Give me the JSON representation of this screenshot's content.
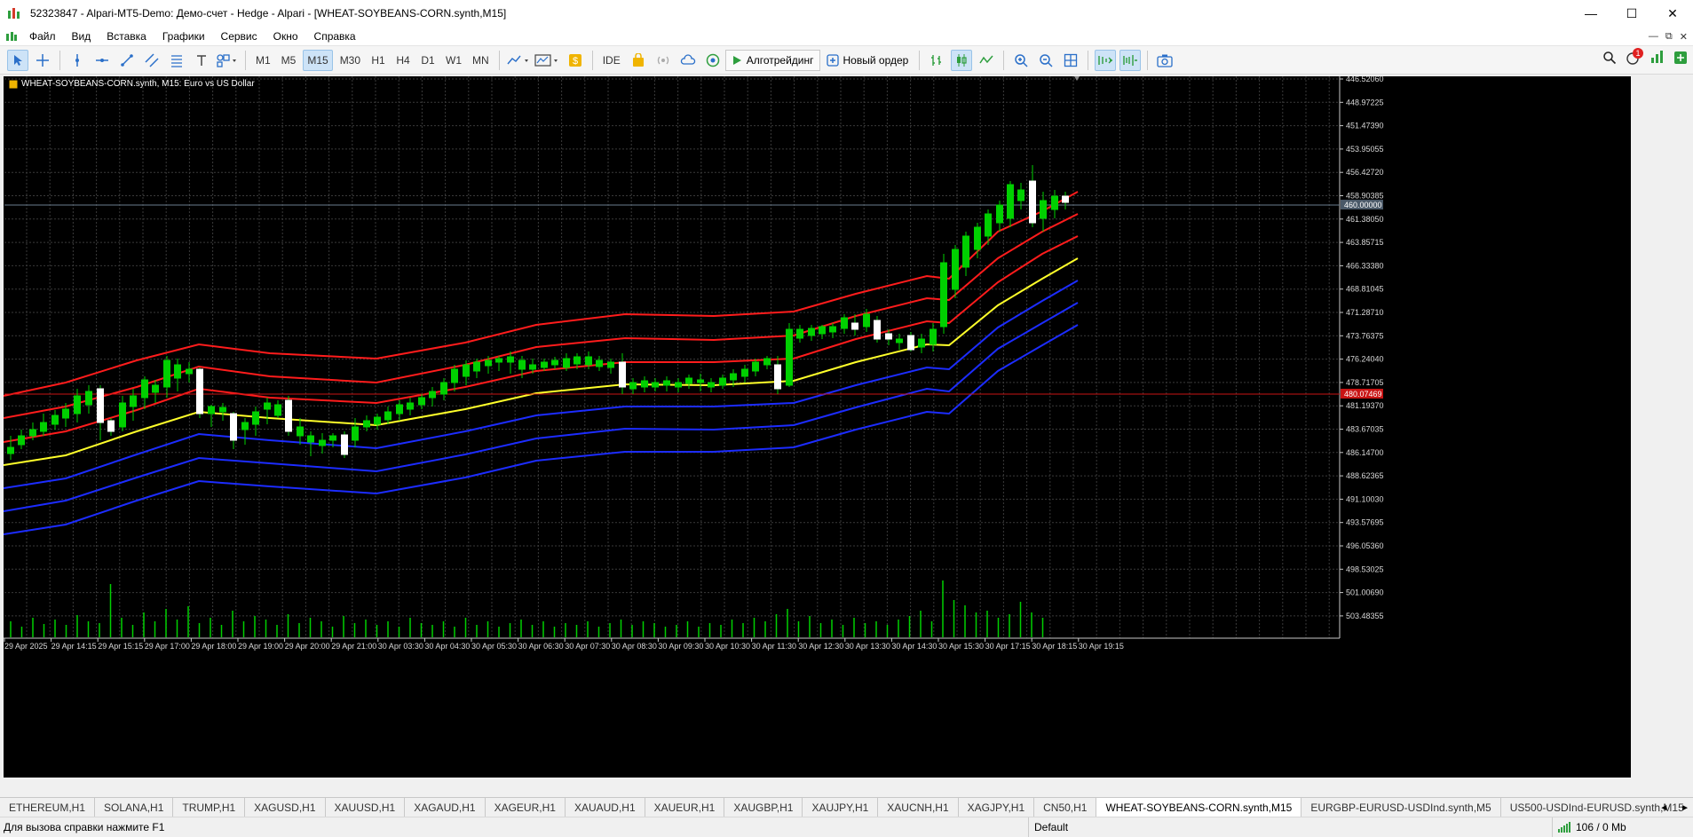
{
  "window": {
    "title": "52323847 - Alpari-MT5-Demo: Демо-счет - Hedge - Alpari - [WHEAT-SOYBEANS-CORN.synth,M15]",
    "minimize": "—",
    "maximize": "☐",
    "close": "✕"
  },
  "menu": {
    "items": [
      "Файл",
      "Вид",
      "Вставка",
      "Графики",
      "Сервис",
      "Окно",
      "Справка"
    ],
    "mdi": [
      "—",
      "⧉",
      "✕"
    ]
  },
  "toolbar": {
    "timeframes": [
      "M1",
      "M5",
      "M15",
      "M30",
      "H1",
      "H4",
      "D1",
      "W1",
      "MN"
    ],
    "active_timeframe": "M15",
    "ide": "IDE",
    "algotrading": "Алготрейдинг",
    "new_order": "Новый ордер",
    "notifications_badge": "1"
  },
  "chart": {
    "symbol_label": "WHEAT-SOYBEANS-CORN.synth, M15:  Euro vs US Dollar",
    "current_price_label": "460.00000",
    "red_line_label": "480.07469"
  },
  "chart_data": {
    "type": "candlestick",
    "title": "WHEAT-SOYBEANS-CORN.synth, M15:  Euro vs US Dollar",
    "y_axis_inverted": true,
    "y_ticks": [
      "446.52060",
      "448.97225",
      "451.47390",
      "453.95055",
      "456.42720",
      "458.90385",
      "461.38050",
      "463.85715",
      "466.33380",
      "468.81045",
      "471.28710",
      "473.76375",
      "476.24040",
      "478.71705",
      "481.19370",
      "483.67035",
      "486.14700",
      "488.62365",
      "491.10030",
      "493.57695",
      "496.05360",
      "498.53025",
      "501.00690",
      "503.48355"
    ],
    "x_ticks": [
      "29 Apr 2025",
      "29 Apr 14:15",
      "29 Apr 15:15",
      "29 Apr 17:00",
      "29 Apr 18:00",
      "29 Apr 19:00",
      "29 Apr 20:00",
      "29 Apr 21:00",
      "30 Apr 03:30",
      "30 Apr 04:30",
      "30 Apr 05:30",
      "30 Apr 06:30",
      "30 Apr 07:30",
      "30 Apr 08:30",
      "30 Apr 09:30",
      "30 Apr 10:30",
      "30 Apr 11:30",
      "30 Apr 12:30",
      "30 Apr 13:30",
      "30 Apr 14:30",
      "30 Apr 15:30",
      "30 Apr 17:15",
      "30 Apr 18:15",
      "30 Apr 19:15"
    ],
    "grid": true,
    "colors": {
      "background": "#000000",
      "grid": "#3a3a3a",
      "candle_body": "#ffffff",
      "candle_wick": "#00d000",
      "volume": "#00d000",
      "band_red": "#ff1c1c",
      "band_yellow": "#ffff2a",
      "band_blue": "#1c2cff"
    }
  },
  "tabs": {
    "items": [
      "ETHEREUM,H1",
      "SOLANA,H1",
      "TRUMP,H1",
      "XAGUSD,H1",
      "XAUUSD,H1",
      "XAGAUD,H1",
      "XAGEUR,H1",
      "XAUAUD,H1",
      "XAUEUR,H1",
      "XAUGBP,H1",
      "XAUJPY,H1",
      "XAUCNH,H1",
      "XAGJPY,H1",
      "CN50,H1",
      "WHEAT-SOYBEANS-CORN.synth,M15",
      "EURGBP-EURUSD-USDInd.synth,M5",
      "US500-USDInd-EURUSD.synth,M15"
    ],
    "active": "WHEAT-SOYBEANS-CORN.synth,M15",
    "left_arrow": "◄",
    "right_arrow": "►"
  },
  "status": {
    "help": "Для вызова справки нажмите F1",
    "profile": "Default",
    "traffic": "106 / 0 Mb"
  }
}
